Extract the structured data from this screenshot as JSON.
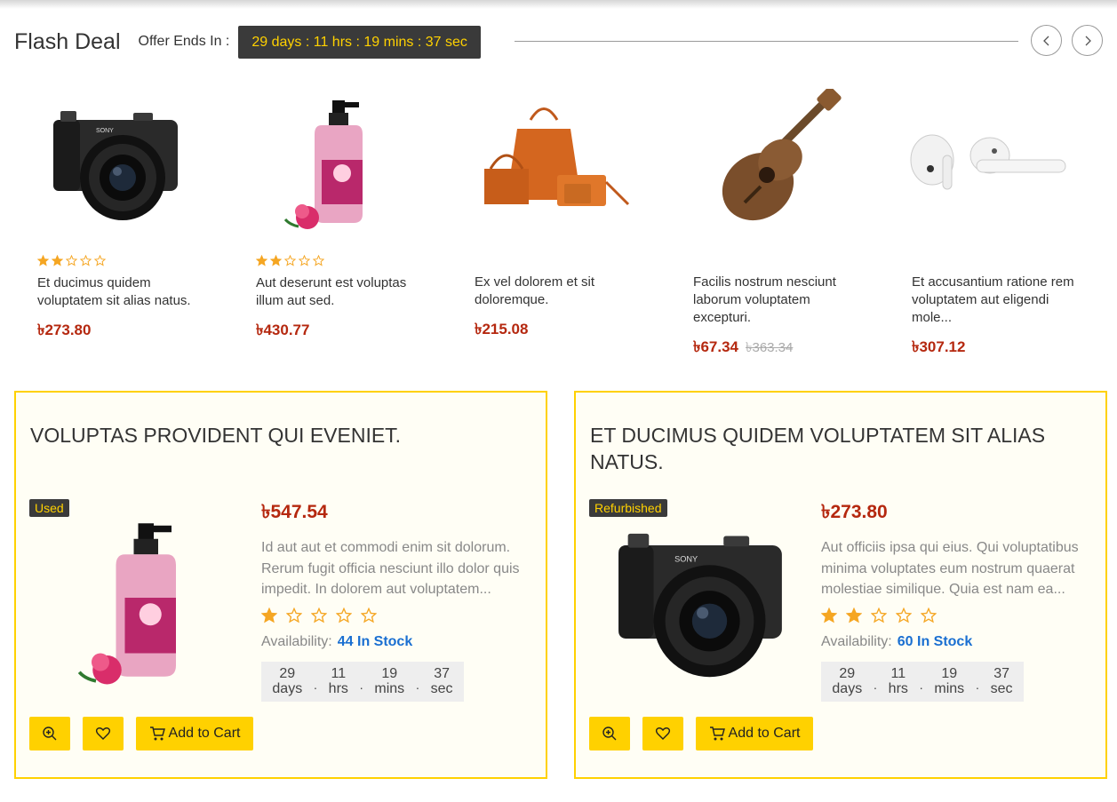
{
  "header": {
    "title": "Flash Deal",
    "offer_label": "Offer Ends In :",
    "countdown": "29 days : 11 hrs : 19 mins : 37 sec",
    "prev_icon": "chevron-left-icon",
    "next_icon": "chevron-right-icon"
  },
  "colors": {
    "accent": "#ffd100",
    "price": "#b5280f",
    "stock": "#1a6fd1",
    "dark": "#3a3a3a"
  },
  "products": [
    {
      "name": "Et ducimus quidem voluptatem sit alias natus.",
      "price": "৳273.80",
      "old_price": "",
      "rating": 2,
      "image_icon": "camera-image"
    },
    {
      "name": "Aut deserunt est voluptas illum aut sed.",
      "price": "৳430.77",
      "old_price": "",
      "rating": 2,
      "image_icon": "soap-bottle-image"
    },
    {
      "name": "Ex vel dolorem et sit doloremque.",
      "price": "৳215.08",
      "old_price": "",
      "rating": 0,
      "image_icon": "handbag-image"
    },
    {
      "name": "Facilis nostrum nesciunt laborum voluptatem excepturi.",
      "price": "৳67.34",
      "old_price": "৳363.34",
      "rating": 0,
      "image_icon": "ukulele-image"
    },
    {
      "name": "Et accusantium ratione rem voluptatem aut eligendi mole...",
      "price": "৳307.12",
      "old_price": "",
      "rating": 0,
      "image_icon": "earbuds-image"
    }
  ],
  "deals": [
    {
      "title": "Voluptas provident qui eveniet.",
      "badge": "Used",
      "price": "৳547.54",
      "description": "Id aut aut et commodi enim sit dolorum. Rerum fugit officia nesciunt illo dolor quis impedit. In dolorem aut voluptatem...",
      "rating": 1,
      "availability_label": "Availability:",
      "stock": "44 In Stock",
      "timer": {
        "days": "29",
        "days_label": "days",
        "hrs": "11",
        "hrs_label": "hrs",
        "mins": "19",
        "mins_label": "mins",
        "sec": "37",
        "sec_label": "sec"
      },
      "cart_label": "Add to Cart",
      "image_icon": "soap-bottle-image"
    },
    {
      "title": "Et ducimus quidem voluptatem sit alias natus.",
      "badge": "Refurbished",
      "price": "৳273.80",
      "description": "Aut officiis ipsa qui eius. Qui voluptatibus minima voluptates eum nostrum quaerat molestiae similique. Quia est nam ea...",
      "rating": 2,
      "availability_label": "Availability:",
      "stock": "60 In Stock",
      "timer": {
        "days": "29",
        "days_label": "days",
        "hrs": "11",
        "hrs_label": "hrs",
        "mins": "19",
        "mins_label": "mins",
        "sec": "37",
        "sec_label": "sec"
      },
      "cart_label": "Add to Cart",
      "image_icon": "camera-image"
    }
  ]
}
